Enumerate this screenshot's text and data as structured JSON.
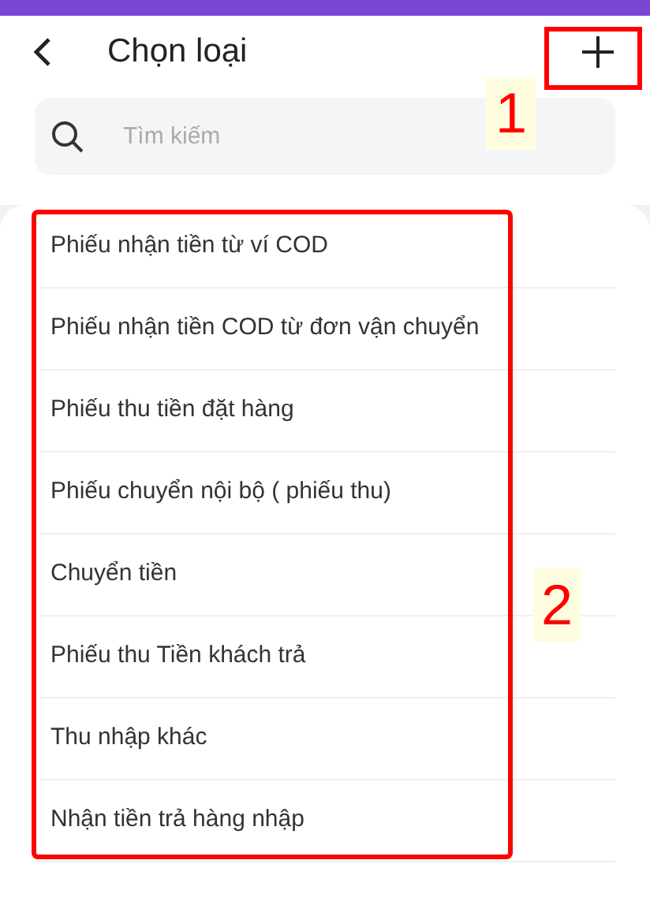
{
  "header": {
    "title": "Chọn loại"
  },
  "search": {
    "placeholder": "Tìm kiếm"
  },
  "items": [
    {
      "label": "Phiếu nhận tiền từ ví COD"
    },
    {
      "label": "Phiếu nhận tiền COD từ đơn vận chuyển"
    },
    {
      "label": "Phiếu thu tiền đặt hàng"
    },
    {
      "label": "Phiếu chuyển nội bộ ( phiếu thu)"
    },
    {
      "label": "Chuyển tiền"
    },
    {
      "label": "Phiếu thu Tiền khách trả"
    },
    {
      "label": "Thu nhập khác"
    },
    {
      "label": "Nhận tiền trả hàng nhập"
    }
  ],
  "annotations": [
    {
      "label": "1"
    },
    {
      "label": "2"
    }
  ]
}
